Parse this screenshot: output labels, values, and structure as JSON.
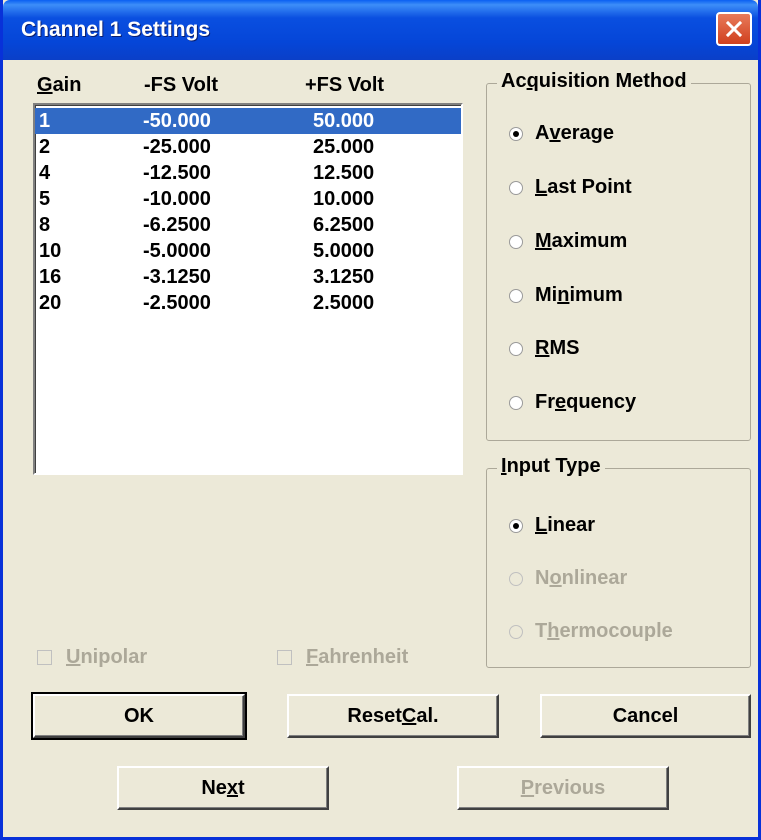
{
  "window": {
    "title": "Channel 1 Settings",
    "close_icon": "close-icon"
  },
  "gain_table": {
    "headers": {
      "gain_pre": "",
      "gain_u": "G",
      "gain_post": "ain",
      "neg": "-FS Volt",
      "pos": "+FS Volt"
    },
    "selected_index": 0,
    "rows": [
      {
        "gain": "1",
        "neg": "-50.000",
        "pos": "50.000"
      },
      {
        "gain": "2",
        "neg": "-25.000",
        "pos": "25.000"
      },
      {
        "gain": "4",
        "neg": "-12.500",
        "pos": "12.500"
      },
      {
        "gain": "5",
        "neg": "-10.000",
        "pos": "10.000"
      },
      {
        "gain": "8",
        "neg": "-6.2500",
        "pos": "6.2500"
      },
      {
        "gain": "10",
        "neg": "-5.0000",
        "pos": "5.0000"
      },
      {
        "gain": "16",
        "neg": "-3.1250",
        "pos": "3.1250"
      },
      {
        "gain": "20",
        "neg": "-2.5000",
        "pos": "2.5000"
      }
    ]
  },
  "acquisition": {
    "legend_pre": "Ac",
    "legend_u": "q",
    "legend_post": "uisition Method",
    "options": [
      {
        "pre": "A",
        "u": "v",
        "post": "erage",
        "checked": true
      },
      {
        "pre": "",
        "u": "L",
        "post": "ast Point",
        "checked": false
      },
      {
        "pre": "",
        "u": "M",
        "post": "aximum",
        "checked": false
      },
      {
        "pre": "Mi",
        "u": "n",
        "post": "imum",
        "checked": false
      },
      {
        "pre": "",
        "u": "R",
        "post": "MS",
        "checked": false
      },
      {
        "pre": "Fr",
        "u": "e",
        "post": "quency",
        "checked": false
      }
    ]
  },
  "input_type": {
    "legend_pre": "",
    "legend_u": "I",
    "legend_post": "nput Type",
    "options": [
      {
        "pre": "",
        "u": "L",
        "post": "inear",
        "checked": true,
        "disabled": false
      },
      {
        "pre": "N",
        "u": "o",
        "post": "nlinear",
        "checked": false,
        "disabled": true
      },
      {
        "pre": "T",
        "u": "h",
        "post": "ermocouple",
        "checked": false,
        "disabled": true
      }
    ]
  },
  "checks": {
    "unipolar": {
      "pre": "",
      "u": "U",
      "post": "nipolar"
    },
    "fahrenheit": {
      "pre": "",
      "u": "F",
      "post": "ahrenheit"
    }
  },
  "buttons": {
    "ok": "OK",
    "reset": {
      "pre": "Reset ",
      "u": "C",
      "post": "al."
    },
    "cancel": "Cancel",
    "next": {
      "pre": "Ne",
      "u": "x",
      "post": "t"
    },
    "previous": {
      "pre": "",
      "u": "P",
      "post": "revious"
    }
  },
  "colors": {
    "title_bar": "#0a4fe0",
    "selection": "#316ac5",
    "dialog_bg": "#ece9d8",
    "disabled_text": "#aca899"
  }
}
